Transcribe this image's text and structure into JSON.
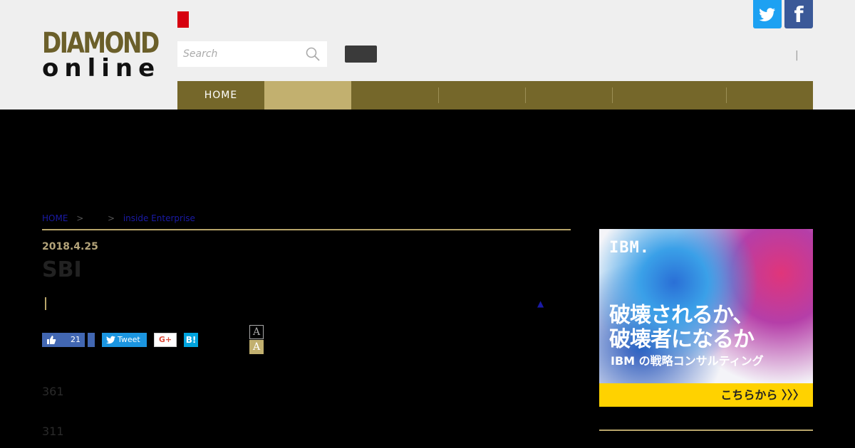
{
  "header": {
    "logo_line1": "DIAMOND",
    "logo_line2": "online",
    "search_placeholder": "Search",
    "separator": "|",
    "facebook_letter": "f"
  },
  "nav": {
    "items": [
      {
        "label": "HOME",
        "active": false
      },
      {
        "label": "　　　　　",
        "active": true
      },
      {
        "label": "　　",
        "active": false
      },
      {
        "label": "　　　　　",
        "active": false
      },
      {
        "label": "　　",
        "active": false
      },
      {
        "label": "　　　　　　　　",
        "active": false
      },
      {
        "label": "　　　",
        "active": false
      }
    ]
  },
  "breadcrumb": {
    "home": "HOME",
    "sep": ">",
    "section": "",
    "category": "inside Enterprise"
  },
  "article": {
    "date": "2018.4.25",
    "title": "SBI",
    "arrow": "▲",
    "font_small": "A",
    "font_large": "A",
    "para1": "361",
    "para2": "311"
  },
  "share": {
    "like_count": "21",
    "tweet_label": "Tweet",
    "gplus_label": "G+",
    "hatena_label": "B!"
  },
  "ad": {
    "brand": "IBM.",
    "headline1": "破壊されるか、",
    "headline2": "破壊者になるか",
    "sub": "IBM の戦略コンサルティング",
    "cta": "こちらから 〉〉〉"
  },
  "colors": {
    "nav_bg": "#75672a",
    "nav_active": "#c2b06f",
    "accent_rule": "#b8a56a",
    "brand_red": "#d6000f"
  }
}
